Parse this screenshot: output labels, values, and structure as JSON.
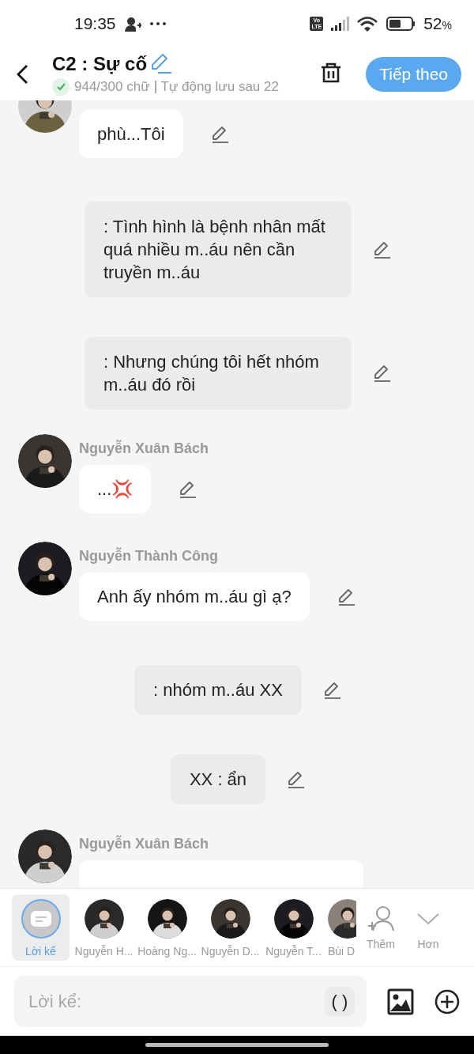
{
  "status_bar": {
    "time": "19:35",
    "battery": "52",
    "battery_unit": "%",
    "network_badge_top": "Vo",
    "network_badge_bottom": "LTE"
  },
  "header": {
    "title": "C2 : Sự cố",
    "word_count": "944/300 chữ",
    "autosave": "Tự động lưu sau 22",
    "next_button": "Tiếp theo"
  },
  "messages": [
    {
      "kind": "character",
      "text": "phù...Tôi"
    },
    {
      "kind": "narration",
      "text": ": Tình hình là bệnh nhân mất quá nhiều m..áu nên cần truyền m..áu"
    },
    {
      "kind": "narration",
      "text": ": Nhưng chúng tôi hết nhóm m..áu đó rồi"
    },
    {
      "kind": "character",
      "name": "Nguyễn Xuân Bách",
      "text": "...💢"
    },
    {
      "kind": "character",
      "name": "Nguyễn Thành Công",
      "text": "Anh ấy nhóm m..áu gì ạ?"
    },
    {
      "kind": "narration",
      "text": ": nhóm m..áu XX"
    },
    {
      "kind": "narration",
      "text": "XX : ẩn"
    },
    {
      "kind": "character",
      "name": "Nguyễn Xuân Bách"
    }
  ],
  "cast_bar": {
    "items": [
      {
        "label": "Lời kể",
        "kind": "narrator",
        "selected": true
      },
      {
        "label": "Nguyễn H...",
        "kind": "character",
        "selected": false
      },
      {
        "label": "Hoàng Ng...",
        "kind": "character",
        "selected": false
      },
      {
        "label": "Nguyễn D...",
        "kind": "character",
        "selected": false
      },
      {
        "label": "Nguyễn T...",
        "kind": "character",
        "selected": false
      },
      {
        "label": "Bùi D",
        "kind": "character",
        "selected": false
      }
    ],
    "add_label": "Thêm",
    "more_label": "Hơn"
  },
  "composer": {
    "placeholder": "Lời kể:",
    "paren_button": "( )"
  }
}
